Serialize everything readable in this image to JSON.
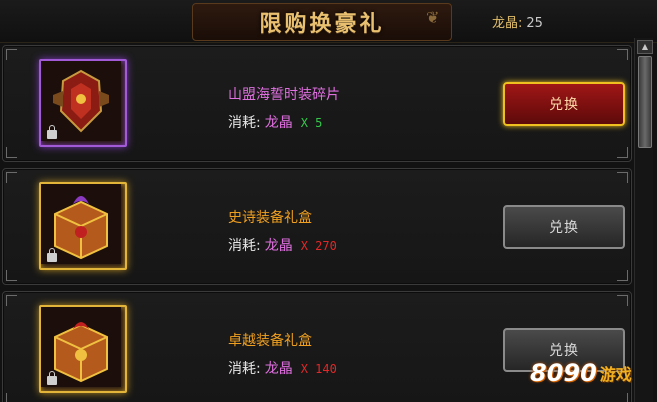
{
  "header": {
    "title": "限购换豪礼",
    "currency_label": "龙晶:",
    "currency_amount": "25"
  },
  "items": [
    {
      "name": "山盟海誓时装碎片",
      "name_color": "#e070e0",
      "cost_label": "消耗:",
      "cost_currency": "龙晶",
      "cost_amount": "X 5",
      "cost_color": "#34c84a",
      "button_label": "兑换",
      "button_state": "active",
      "frame": "purple"
    },
    {
      "name": "史诗装备礼盒",
      "name_color": "#f0a020",
      "cost_label": "消耗:",
      "cost_currency": "龙晶",
      "cost_amount": "X 270",
      "cost_color": "#e02828",
      "button_label": "兑换",
      "button_state": "disabled",
      "frame": "gold"
    },
    {
      "name": "卓越装备礼盒",
      "name_color": "#f0a020",
      "cost_label": "消耗:",
      "cost_currency": "龙晶",
      "cost_amount": "X 140",
      "cost_color": "#e02828",
      "button_label": "兑换",
      "button_state": "disabled",
      "frame": "gold"
    }
  ],
  "watermark": {
    "digits": "8090",
    "text": "游戏"
  }
}
